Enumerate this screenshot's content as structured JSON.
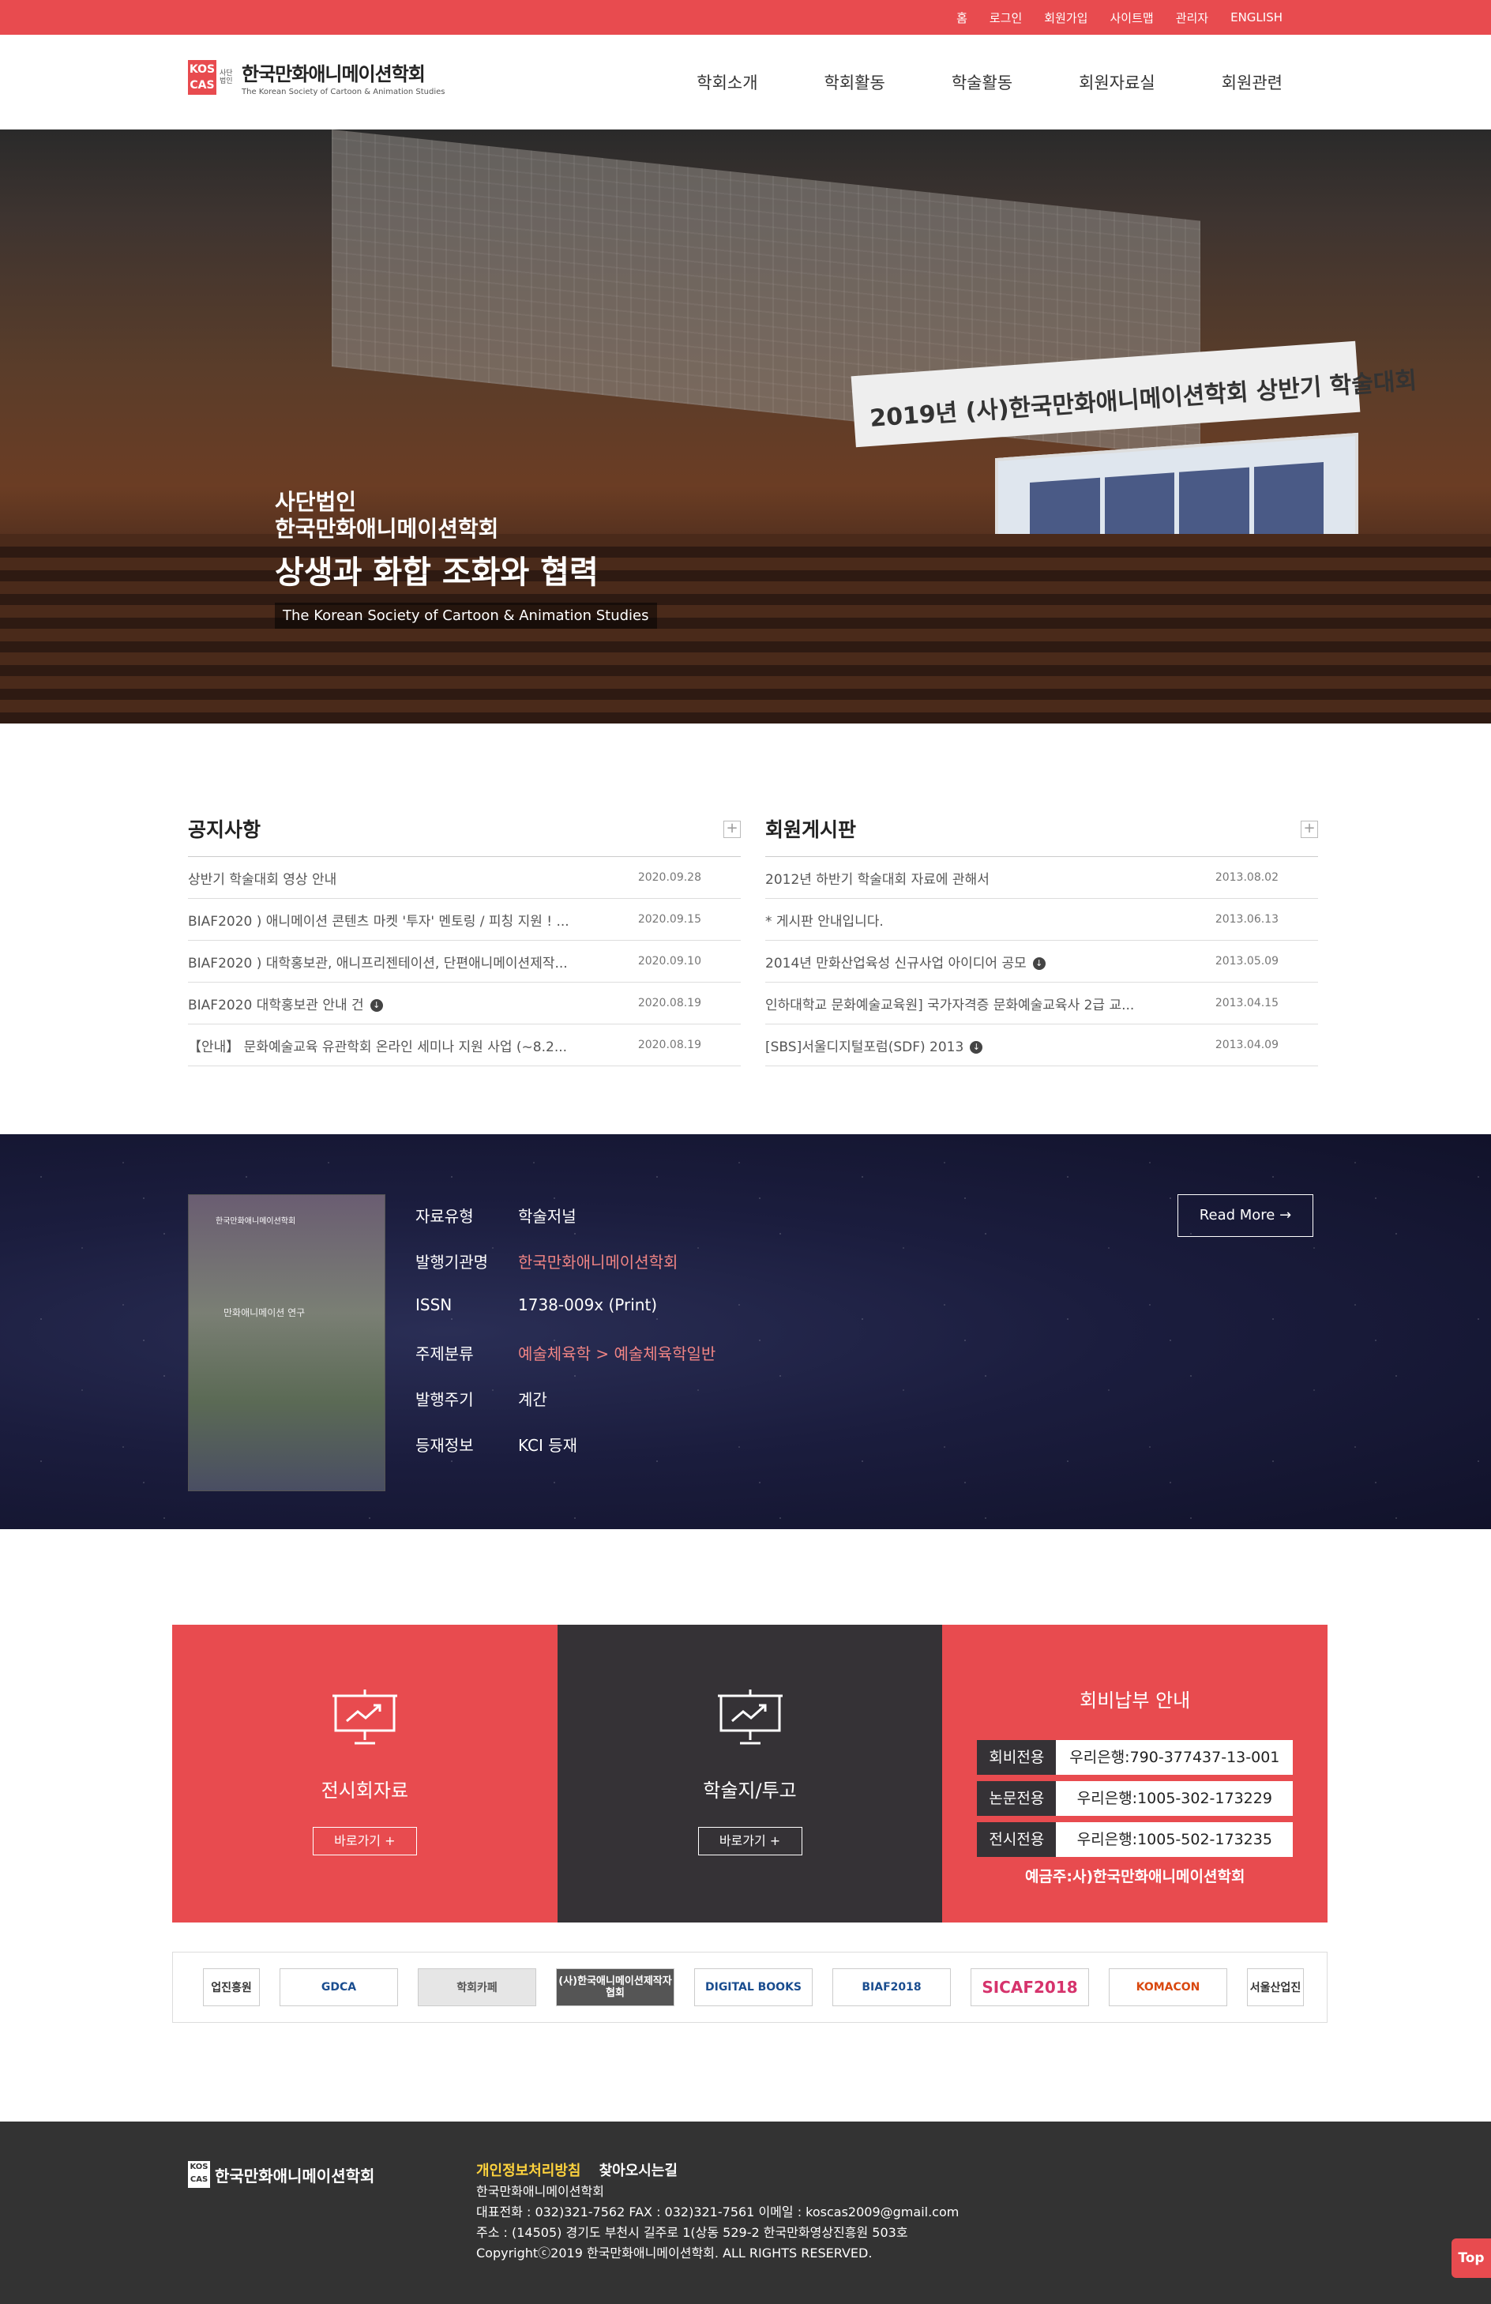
{
  "topbar": {
    "links": [
      "홈",
      "로그인",
      "회원가입",
      "사이트맵",
      "관리자",
      "ENGLISH"
    ]
  },
  "logo": {
    "mark": "KOS CAS",
    "small": "사단 법인",
    "title": "한국만화애니메이션학회",
    "subtitle": "The Korean Society of Cartoon & Animation Studies"
  },
  "nav": {
    "items": [
      "학회소개",
      "학회활동",
      "학술활동",
      "회원자료실",
      "회원관련"
    ]
  },
  "hero": {
    "line1": "사단법인",
    "line2": "한국만화애니메이션학회",
    "line3": "상생과 화합 조화와 협력",
    "line4": "The Korean Society of Cartoon & Animation Studies",
    "banner": "2019년 (사)한국만화애니메이션학회 상반기 학술대회",
    "slide_count": 4,
    "active_slide": 1
  },
  "notice": {
    "title": "공지사항",
    "more": "+",
    "rows": [
      {
        "title": "상반기 학술대회 영상 안내",
        "date": "2020.09.28",
        "file": false
      },
      {
        "title": "BIAF2020 ) 애니메이션 콘텐츠 마켓 '투자' 멘토링 / 피칭 지원 ! ...",
        "date": "2020.09.15",
        "file": false
      },
      {
        "title": "BIAF2020 ) 대학홍보관, 애니프리젠테이션, 단편애니메이션제작...",
        "date": "2020.09.10",
        "file": false
      },
      {
        "title": "BIAF2020 대학홍보관 안내 건",
        "date": "2020.08.19",
        "file": true
      },
      {
        "title": "【안내】 문화예술교육 유관학회 온라인 세미나 지원 사업 (~8.2...",
        "date": "2020.08.19",
        "file": false
      }
    ]
  },
  "member_board": {
    "title": "회원게시판",
    "more": "+",
    "rows": [
      {
        "title": "2012년 하반기 학술대회 자료에 관해서",
        "date": "2013.08.02",
        "file": false
      },
      {
        "title": "* 게시판 안내입니다.",
        "date": "2013.06.13",
        "file": false
      },
      {
        "title": "2014년 만화산업육성 신규사업 아이디어 공모",
        "date": "2013.05.09",
        "file": true
      },
      {
        "title": "인하대학교 문화예술교육원] 국가자격증 문화예술교육사 2급 교...",
        "date": "2013.04.15",
        "file": false
      },
      {
        "title": "[SBS]서울디지털포럼(SDF) 2013",
        "date": "2013.04.09",
        "file": true
      }
    ]
  },
  "journal": {
    "cover_title": "한국만화애니메이션학회",
    "cover_name": "만화애니메이션 연구",
    "fields": [
      {
        "key": "자료유형",
        "value": "학술저널",
        "red": false
      },
      {
        "key": "발행기관명",
        "value": "한국만화애니메이션학회",
        "red": true
      },
      {
        "key": "ISSN",
        "value": "1738-009x (Print)",
        "red": false
      },
      {
        "key": "주제분류",
        "value": "예술체육학 > 예술체육학일반",
        "red": true
      },
      {
        "key": "발행주기",
        "value": "계간",
        "red": false
      },
      {
        "key": "등재정보",
        "value": "KCI 등재",
        "red": false
      }
    ],
    "read_more": "Read More →"
  },
  "quick": {
    "box1": {
      "title": "전시회자료",
      "button": "바로가기  +",
      "icon": "presentation-icon"
    },
    "box2": {
      "title": "학술지/투고",
      "button": "바로가기  +",
      "icon": "presentation-icon"
    },
    "fee": {
      "title": "회비납부 안내",
      "rows": [
        {
          "key": "회비전용",
          "value": "우리은행:790-377437-13-001"
        },
        {
          "key": "논문전용",
          "value": "우리은행:1005-302-173229"
        },
        {
          "key": "전시전용",
          "value": "우리은행:1005-502-173235"
        }
      ],
      "note": "예금주:사)한국만화애니메이션학회"
    }
  },
  "partners": [
    "업진흥원",
    "GDCA",
    "학회카페",
    "(사)한국애니메이션제작자협회",
    "DIGITAL BOOKS",
    "BIAF2018",
    "SICAF2018",
    "KOMACON",
    "서울산업진"
  ],
  "footer": {
    "logo": "한국만화애니메이션학회",
    "links": [
      "개인정보처리방침",
      "찾아오시는길"
    ],
    "lines": [
      "한국만화애니메이션학회",
      "대표전화 : 032)321-7562    FAX : 032)321-7561    이메일 : koscas2009@gmail.com",
      "주소 : (14505) 경기도 부천시 길주로 1(상동 529-2 한국만화영상진흥원 503호",
      "Copyrightⓒ2019 한국만화애니메이션학회. ALL RIGHTS RESERVED."
    ],
    "top_button": "Top"
  }
}
